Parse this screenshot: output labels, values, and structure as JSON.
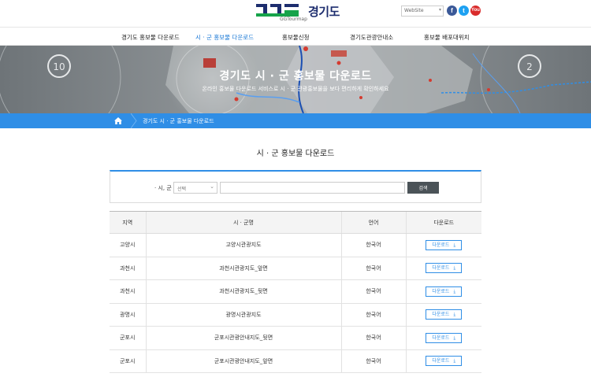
{
  "header": {
    "logo_text": "경기도",
    "logo_sub": "GGTourmap",
    "site_select": "WebSite",
    "sns": {
      "facebook": "f",
      "twitter": "t",
      "youtube": "You"
    }
  },
  "nav": {
    "items": [
      {
        "label": "경기도 홍보물 다운로드"
      },
      {
        "label": "시 · 군 홍보물 다운로드"
      },
      {
        "label": "홍보물신청"
      },
      {
        "label": "경기도관광안내소"
      },
      {
        "label": "홍보물 배포대위치"
      }
    ]
  },
  "banner": {
    "title": "경기도 시 · 군 홍보물 다운로드",
    "subtitle": "온라인 홍보물 다운로드 서비스로 시 · 군 관광홍보물을 보다 편리하게 확인하세요",
    "badge_left": "10",
    "badge_right": "2"
  },
  "breadcrumb": {
    "current": "경기도 시 · 군 홍보물 다운로드"
  },
  "content": {
    "heading": "시 · 군 홍보물 다운로드",
    "search": {
      "label": "· 시, 군",
      "select_value": "선택",
      "input_value": "",
      "button_label": "검색"
    },
    "table": {
      "headers": [
        "지역",
        "시 · 군명",
        "언어",
        "다운로드"
      ],
      "rows": [
        {
          "region": "고양시",
          "name": "고양시관광지도",
          "lang": "한국어",
          "download": "다운로드"
        },
        {
          "region": "과천시",
          "name": "과천시관광지도_앞면",
          "lang": "한국어",
          "download": "다운로드"
        },
        {
          "region": "과천시",
          "name": "과천시관광지도_뒷면",
          "lang": "한국어",
          "download": "다운로드"
        },
        {
          "region": "광명시",
          "name": "광명시관광지도",
          "lang": "한국어",
          "download": "다운로드"
        },
        {
          "region": "군포시",
          "name": "군포시관광안내지도_뒷면",
          "lang": "한국어",
          "download": "다운로드"
        },
        {
          "region": "군포시",
          "name": "군포시관광안내지도_앞면",
          "lang": "한국어",
          "download": "다운로드"
        }
      ]
    }
  },
  "colors": {
    "accent": "#2f8ee6",
    "nav_active": "#1a78d6",
    "logo_navy": "#1d2d6e",
    "logo_green": "#16a34a",
    "button_dark": "#4b5358"
  }
}
